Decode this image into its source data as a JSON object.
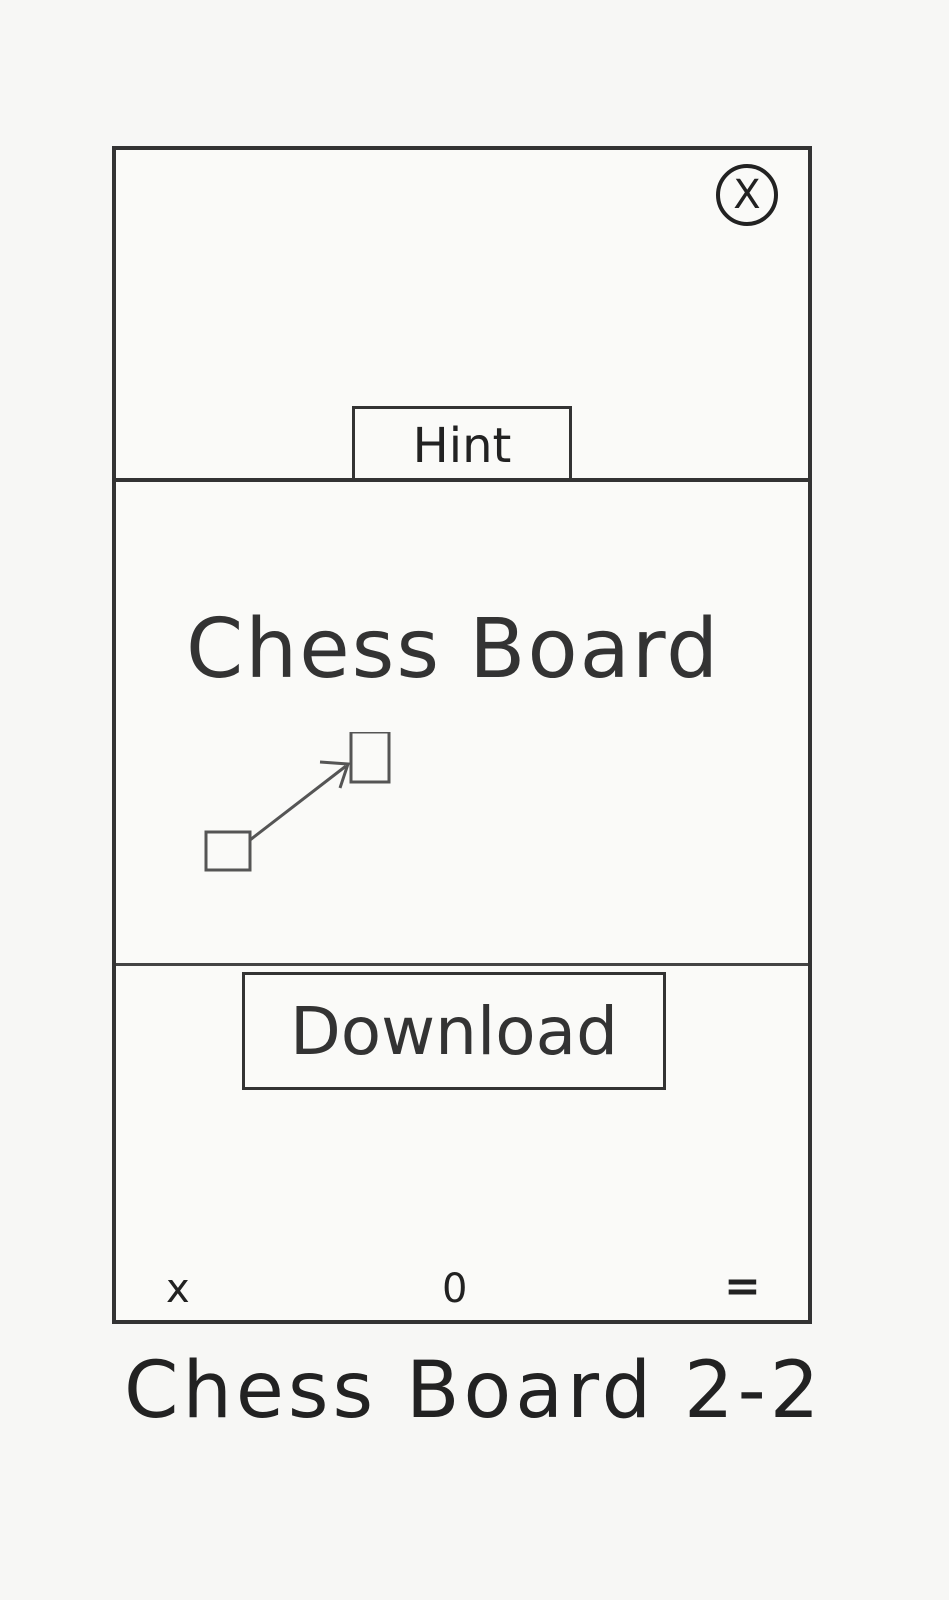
{
  "header": {
    "close_symbol": "X",
    "close_icon": "close-circle-icon",
    "hint_label": "Hint"
  },
  "main": {
    "title": "Chess Board"
  },
  "actions": {
    "download_label": "Download"
  },
  "nav": {
    "back_symbol": "x",
    "home_symbol": "0",
    "menu_symbol": "="
  },
  "caption": "Chess Board 2-2"
}
